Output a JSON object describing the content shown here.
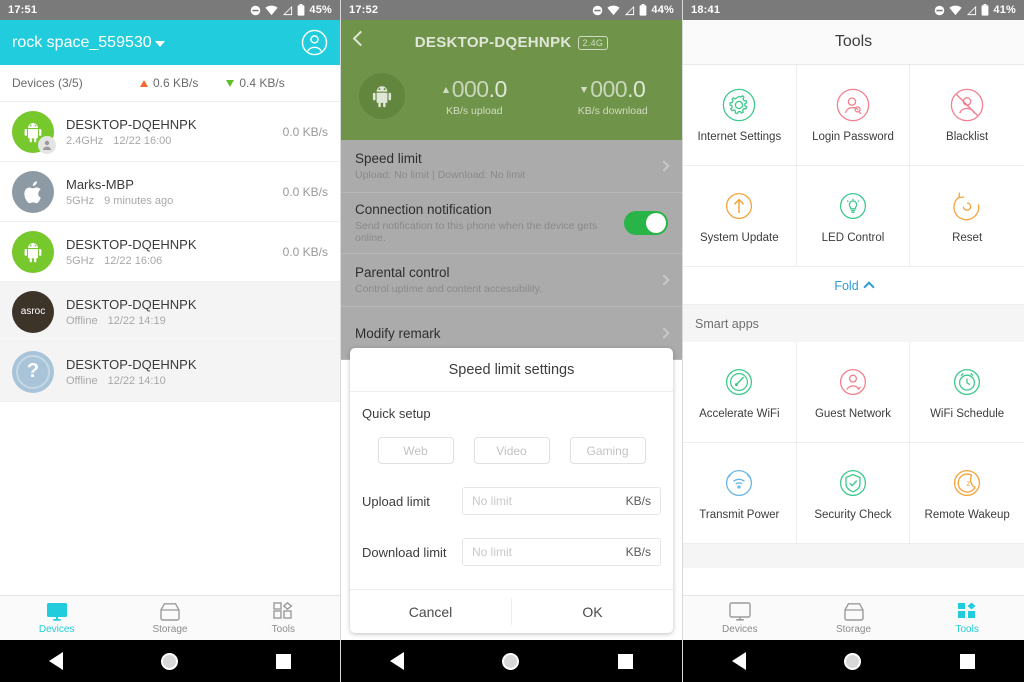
{
  "screens": {
    "devices": {
      "status_bar": {
        "time": "17:51",
        "battery": "45%"
      },
      "header": {
        "ssid": "rock space_559530",
        "account_icon": "account-circle-icon"
      },
      "summary": {
        "devices_label": "Devices (3/5)",
        "upload": "0.6  KB/s",
        "download": "0.4  KB/s"
      },
      "device_list": [
        {
          "avatar": "android-icon",
          "name": "DESKTOP-DQEHNPK",
          "band": "2.4GHz",
          "time": "12/22 16:00",
          "rate": "0.0  KB/s",
          "offline": false,
          "owner_badge": true
        },
        {
          "avatar": "apple-icon",
          "name": "Marks-MBP",
          "band": "5GHz",
          "time": "9 minutes ago",
          "rate": "0.0  KB/s",
          "offline": false,
          "owner_badge": false
        },
        {
          "avatar": "android-icon",
          "name": "DESKTOP-DQEHNPK",
          "band": "5GHz",
          "time": "12/22 16:06",
          "rate": "0.0  KB/s",
          "offline": false,
          "owner_badge": false
        },
        {
          "avatar": "asroc-text",
          "name": "DESKTOP-DQEHNPK",
          "band": "Offline",
          "time": "12/22 14:19",
          "rate": "",
          "offline": true,
          "owner_badge": false
        },
        {
          "avatar": "question-icon",
          "name": "DESKTOP-DQEHNPK",
          "band": "Offline",
          "time": "12/22 14:10",
          "rate": "",
          "offline": true,
          "owner_badge": false
        }
      ],
      "tabs": [
        {
          "label": "Devices",
          "icon": "monitor-icon",
          "active": true
        },
        {
          "label": "Storage",
          "icon": "drive-icon",
          "active": false
        },
        {
          "label": "Tools",
          "icon": "grid-icon",
          "active": false
        }
      ]
    },
    "device_detail": {
      "status_bar": {
        "time": "17:52",
        "battery": "44%"
      },
      "header": {
        "back_icon": "back-chevron-icon",
        "title": "DESKTOP-DQEHNPK",
        "band_badge": "2.4G",
        "avatar": "android-icon",
        "upload": {
          "dim": "000",
          "value": ".0",
          "label": "KB/s upload"
        },
        "download": {
          "dim": "000",
          "value": ".0",
          "label": "KB/s download"
        }
      },
      "settings": [
        {
          "title": "Speed limit",
          "subtitle": "Upload: No limit | Download: No limit",
          "control": "chevron"
        },
        {
          "title": "Connection notification",
          "subtitle": "Send notification to this phone when the device gets online.",
          "control": "toggle_on"
        },
        {
          "title": "Parental control",
          "subtitle": "Control uptime and content accessibility.",
          "control": "chevron"
        },
        {
          "title": "Modify remark",
          "subtitle": "",
          "control": "chevron"
        }
      ],
      "dialog": {
        "title": "Speed limit settings",
        "quick_setup_label": "Quick setup",
        "chips": [
          "Web",
          "Video",
          "Gaming"
        ],
        "upload_label": "Upload limit",
        "upload_placeholder": "No limit",
        "upload_unit": "KB/s",
        "download_label": "Download limit",
        "download_placeholder": "No limit",
        "download_unit": "KB/s",
        "cancel": "Cancel",
        "ok": "OK"
      }
    },
    "tools": {
      "status_bar": {
        "time": "18:41",
        "battery": "41%"
      },
      "header": {
        "title": "Tools"
      },
      "tools_grid": [
        {
          "label": "Internet Settings",
          "icon": "gear-icon",
          "color": "#3ec98d"
        },
        {
          "label": "Login Password",
          "icon": "user-key-icon",
          "color": "#f2808f"
        },
        {
          "label": "Blacklist",
          "icon": "user-block-icon",
          "color": "#f2808f"
        },
        {
          "label": "System Update",
          "icon": "upload-arrow-icon",
          "color": "#f5a councils"
        },
        {
          "label": "LED Control",
          "icon": "bulb-icon",
          "color": "#3ec98d"
        },
        {
          "label": "Reset",
          "icon": "reset-icon",
          "color": "#f5a33c"
        }
      ],
      "fold": {
        "label": "Fold",
        "icon": "chevron-up-icon"
      },
      "smart_apps_label": "Smart apps",
      "smart_apps_grid": [
        {
          "label": "Accelerate WiFi",
          "icon": "speedometer-icon",
          "color": "#3ec98d"
        },
        {
          "label": "Guest Network",
          "icon": "guest-user-icon",
          "color": "#f2808f"
        },
        {
          "label": "WiFi Schedule",
          "icon": "alarm-clock-icon",
          "color": "#3ec98d"
        },
        {
          "label": "Transmit Power",
          "icon": "wifi-power-icon",
          "color": "#6bb6e8"
        },
        {
          "label": "Security Check",
          "icon": "shield-check-icon",
          "color": "#3ec98d"
        },
        {
          "label": "Remote Wakeup",
          "icon": "moon-sleep-icon",
          "color": "#f5a33c"
        }
      ],
      "tabs": [
        {
          "label": "Devices",
          "icon": "monitor-icon",
          "active": false
        },
        {
          "label": "Storage",
          "icon": "drive-icon",
          "active": false
        },
        {
          "label": "Tools",
          "icon": "grid-icon",
          "active": true
        }
      ]
    }
  },
  "colors": {
    "teal": "#21cddd",
    "green": "#7ec14c",
    "toggle_on": "#28b446",
    "link": "#2e9bd6"
  }
}
